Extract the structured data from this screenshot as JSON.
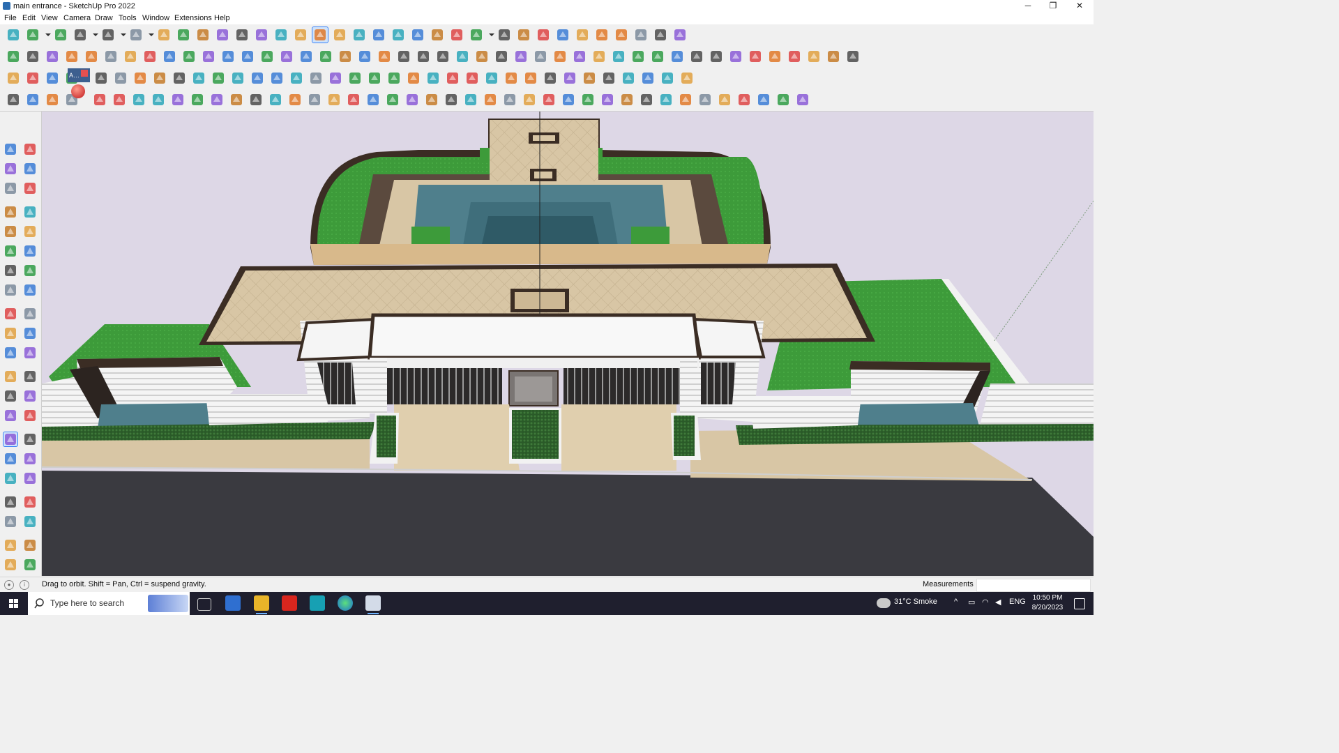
{
  "window": {
    "title": "main entrance - SketchUp Pro 2022",
    "app_icon": "sketchup-icon",
    "controls": [
      {
        "name": "minimize",
        "glyph": "─"
      },
      {
        "name": "restore",
        "glyph": "❐"
      },
      {
        "name": "close",
        "glyph": "✕"
      }
    ]
  },
  "menu": [
    "File",
    "Edit",
    "View",
    "Camera",
    "Draw",
    "Tools",
    "Window",
    "Extensions",
    "Help"
  ],
  "toolbars": {
    "row1": [
      "zoom-icon",
      "select-icon",
      "dropdown",
      "eraser-icon",
      "line-icon",
      "dropdown",
      "arc-icon",
      "dropdown",
      "rectangle-icon",
      "dropdown",
      "push-pull-icon",
      "follow-me-icon",
      "move-icon",
      "rotate-icon",
      "scale-icon",
      "tape-measure-icon",
      "text-icon",
      "paint-bucket-icon",
      "orbit-icon",
      "pan-icon",
      "zoom-icon",
      "zoom-extents-icon",
      "iso-view-icon",
      "top-view-icon",
      "front-view-icon",
      "right-view-icon",
      "profile-icon",
      "dropdown",
      "section-plane-icon",
      "section-display-icon",
      "axes-icon",
      "move-up-icon",
      "move-down-icon",
      "scale-tool-icon",
      "dimension-icon",
      "undo-icon",
      "redo-icon",
      "extension-icon"
    ],
    "row2": [
      "box-icon",
      "sphere-icon",
      "cylinder-icon",
      "extrude-icon",
      "push-icon",
      "push-icon",
      "push-icon",
      "push-icon",
      "push-icon",
      "push-icon",
      "push-icon",
      "curve-icon",
      "plane-icon",
      "plane-icon",
      "plane-icon",
      "face-icon",
      "face-icon",
      "house-icon",
      "door-icon",
      "home-icon",
      "roof-icon",
      "garage-icon",
      "function-icon",
      "leaf-icon",
      "pencil-icon",
      "rectangle-icon",
      "circle-icon",
      "hexagon-icon",
      "ellipse-icon",
      "parallelogram-icon",
      "arc-icon",
      "polygon-icon",
      "spiral-icon",
      "lasso-icon",
      "knot-icon",
      "arrow-icon",
      "eraser-icon",
      "material-icon",
      "mesh-icon",
      "terrain-icon",
      "cube-icon",
      "hand-icon",
      "solid-icon",
      "solid-icon"
    ],
    "row3": [
      "plane-icon",
      "plane-icon",
      "plane-icon",
      "paint-icon",
      "hoop-icon",
      "red-rect-icon",
      "stack-icon",
      "flag-icon",
      "pipe-icon",
      "rail-icon",
      "path-icon",
      "cross-icon",
      "plus-icon",
      "tools-icon",
      "cone-icon",
      "fountain-icon",
      "triangle-icon",
      "loop-icon",
      "recycle-icon",
      "cycle-icon",
      "compass-icon",
      "bucket-icon",
      "turn-icon",
      "gift-icon",
      "box-icon",
      "box-icon",
      "bow-icon",
      "gear-icon",
      "window-icon",
      "grid-icon",
      "grid-icon",
      "grid-icon",
      "x-icon",
      "dots-icon",
      "grid-icon"
    ],
    "row4": [
      "node-icon",
      "curve-icon",
      "car-icon",
      "stairs-icon",
      "sheet-icon",
      "rope-icon",
      "cube-icon",
      "web-icon",
      "stairs-icon",
      "railing-icon",
      "railing-icon",
      "railing-icon",
      "railing-icon",
      "railing-icon",
      "railing-icon",
      "railing-icon",
      "railing-icon",
      "railing-icon",
      "railing-icon",
      "railing-icon",
      "railing-icon",
      "railing-icon",
      "railing-icon",
      "railing-icon",
      "railing-icon",
      "railing-icon",
      "railing-icon",
      "railing-icon",
      "railing-icon",
      "railing-icon",
      "railing-icon",
      "railing-icon",
      "railing-icon",
      "railing-icon",
      "railing-icon",
      "railing-icon",
      "railing-icon",
      "railing-icon",
      "railing-icon",
      "railing-icon",
      "railing-icon"
    ],
    "text_tool_label": "A…"
  },
  "sidebar_tools": [
    [
      "select-icon",
      "orbit-icon"
    ],
    [
      "paint-bucket-icon",
      "eraser-icon"
    ],
    [
      "component-icon",
      "tag-icon"
    ],
    [
      "line-icon",
      "freehand-icon"
    ],
    [
      "rectangle-icon",
      "rotated-rectangle-icon"
    ],
    [
      "circle-icon",
      "polygon-icon"
    ],
    [
      "arc-icon",
      "two-point-arc-icon"
    ],
    [
      "three-point-arc-icon",
      "pie-icon"
    ],
    [
      "move-icon",
      "push-pull-icon"
    ],
    [
      "rotate-icon",
      "follow-me-icon"
    ],
    [
      "scale-icon",
      "offset-icon"
    ],
    [
      "tape-measure-icon",
      "dimension-icon"
    ],
    [
      "protractor-icon",
      "text-icon"
    ],
    [
      "axes-icon",
      "3d-text-icon"
    ],
    [
      "orbit-icon",
      "pan-icon"
    ],
    [
      "zoom-icon",
      "zoom-window-icon"
    ],
    [
      "zoom-extents-icon",
      "previous-view-icon"
    ],
    [
      "position-camera-icon",
      "look-around-icon"
    ],
    [
      "walk-icon",
      "section-plane-icon"
    ],
    [
      "warehouse-icon",
      "extension-warehouse-icon"
    ],
    [
      "layers-icon",
      "styles-icon"
    ]
  ],
  "status": {
    "hint": "Drag to orbit. Shift = Pan, Ctrl = suspend gravity.",
    "measurements_label": "Measurements",
    "measurements_value": ""
  },
  "taskbar": {
    "search_placeholder": "Type here to search",
    "apps": [
      "task-view-icon",
      "calculator-icon",
      "file-explorer-icon",
      "acrobat-icon",
      "3dsmax-icon",
      "edge-icon",
      "sketchup-icon"
    ],
    "weather": "31°C  Smoke",
    "language": "ENG",
    "time": "10:50 PM",
    "date": "8/20/2023"
  },
  "colors": {
    "grass": "#3d9b3a",
    "paving": "#d8c6a5",
    "water": "#4f7f8c",
    "road": "#3a3a40",
    "sky": "#ddd7e6",
    "wall": "#ffffff",
    "trim": "#3b2d24"
  }
}
